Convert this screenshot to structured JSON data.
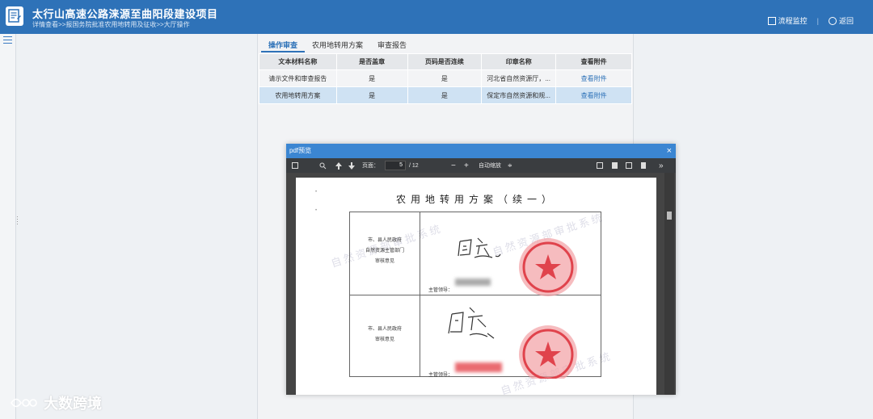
{
  "header": {
    "title": "太行山高速公路涞源至曲阳段建设项目",
    "breadcrumb": "详情查看>>报国务院批准农用地转用及征收>>大厅操作",
    "flow_monitor_label": "流程监控",
    "back_label": "返回"
  },
  "tabs": [
    {
      "label": "操作审查",
      "active": true
    },
    {
      "label": "农用地转用方案",
      "active": false
    },
    {
      "label": "审查报告",
      "active": false
    }
  ],
  "table": {
    "headers": [
      "文本材料名称",
      "是否盖章",
      "页码是否连续",
      "印章名称",
      "查看附件"
    ],
    "rows": [
      [
        "请示文件和审查报告",
        "是",
        "是",
        "河北省自然资源厅，...",
        "查看附件"
      ],
      [
        "农用地转用方案",
        "是",
        "是",
        "保定市自然资源和规...",
        "查看附件"
      ]
    ]
  },
  "pdf_dialog": {
    "title": "pdf预览",
    "close": "×",
    "page_label": "页面：",
    "page_current": "5",
    "page_total": "/ 12",
    "zoom_minus": "−",
    "zoom_plus": "+",
    "zoom_select": "自动缩放",
    "zoom_caret": "≑",
    "more": "»"
  },
  "document": {
    "title": "农用地转用方案（续一）",
    "cell1_label": [
      "市、县人民政府",
      "自然资源主管部门",
      "审核意见"
    ],
    "cell2_label": [
      "市、县人民政府",
      "审核意见"
    ],
    "supervisor_label": "主管领导：",
    "supervisor_label_2": "主管领导：",
    "watermark": "自然资源部审批系统"
  },
  "brand": {
    "text": "大数跨境"
  },
  "colors": {
    "header": "#2e72b8",
    "link": "#2e72b8",
    "selected_row": "#cfe2f3",
    "dialog_head": "#3b86d2",
    "stamp": "#e0434c"
  }
}
